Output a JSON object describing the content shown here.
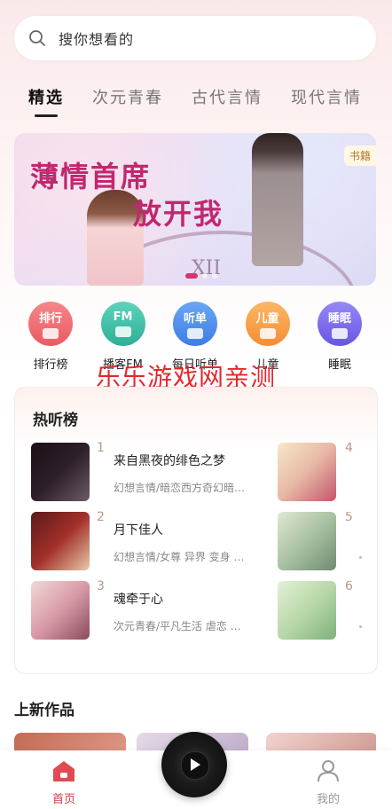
{
  "search": {
    "placeholder": "搜你想看的",
    "icon": "search-icon"
  },
  "tabs": [
    {
      "label": "精选",
      "active": true
    },
    {
      "label": "次元青春",
      "active": false
    },
    {
      "label": "古代言情",
      "active": false
    },
    {
      "label": "现代言情",
      "active": false
    }
  ],
  "banner": {
    "title_line1": "薄情首席",
    "title_line2": "放开我",
    "tag": "书籍",
    "clock_text": "XII",
    "page_index": 1,
    "page_count": 3
  },
  "categories": [
    {
      "badge": "排行",
      "label": "排行榜",
      "color": "#ef6b71"
    },
    {
      "badge": "FM",
      "label": "播客FM",
      "color": "#3fc2a8"
    },
    {
      "badge": "听单",
      "label": "每日听单",
      "color": "#4f8ff0"
    },
    {
      "badge": "儿童",
      "label": "儿童",
      "color": "#f8a24a"
    },
    {
      "badge": "睡眠",
      "label": "睡眠",
      "color": "#7c6cf0"
    }
  ],
  "watermark": "乐乐游戏网亲测",
  "hot": {
    "heading": "热听榜",
    "left": [
      {
        "rank": "1",
        "title": "来自黑夜的绯色之梦",
        "tags": "幻想言情/暗恋西方奇幻暗…"
      },
      {
        "rank": "2",
        "title": "月下佳人",
        "tags": "幻想言情/女尊 异界 变身 …"
      },
      {
        "rank": "3",
        "title": "魂牵于心",
        "tags": "次元青春/平凡生活 虐恋 …"
      }
    ],
    "right": [
      {
        "rank": "4"
      },
      {
        "rank": "5"
      },
      {
        "rank": "6"
      }
    ]
  },
  "new_works": {
    "heading": "上新作品"
  },
  "tabbar": {
    "home": {
      "label": "首页",
      "icon": "home-icon",
      "active": true
    },
    "me": {
      "label": "我的",
      "icon": "user-icon",
      "active": false
    },
    "player_icon": "play-icon"
  }
}
